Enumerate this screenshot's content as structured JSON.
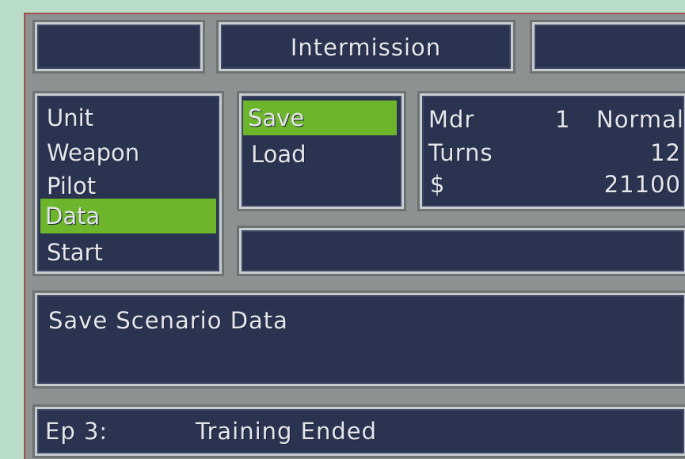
{
  "header": {
    "title": "Intermission"
  },
  "main_menu": {
    "items": [
      "Unit",
      "Weapon",
      "Pilot",
      "Data",
      "Start"
    ],
    "selected_index": 3
  },
  "sub_menu": {
    "items": [
      "Save",
      "Load"
    ],
    "selected_index": 0
  },
  "status": {
    "mode_label": "Mdr",
    "mode_number": "1",
    "mode_value": "Normal",
    "turns_label": "Turns",
    "turns_value": "12",
    "money_symbol": "$",
    "money_value": "21100"
  },
  "help_text": "Save Scenario Data",
  "footer": {
    "episode": "Ep 3:",
    "scenario": "Training Ended"
  },
  "colors": {
    "panel": "#2a3350",
    "highlight": "#6db52b",
    "frame": "#8d9191"
  }
}
